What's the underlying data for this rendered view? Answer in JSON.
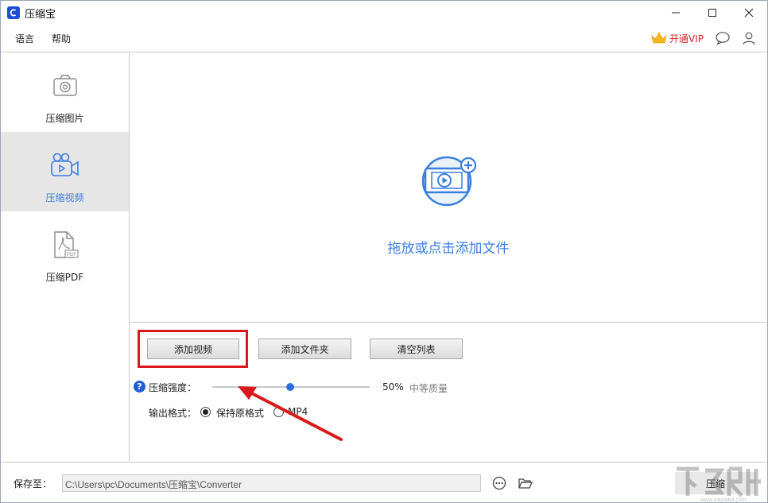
{
  "window": {
    "title": "压缩宝",
    "minimize_icon": "minimize-icon",
    "maximize_icon": "maximize-icon",
    "close_icon": "close-icon"
  },
  "menu": {
    "items": [
      "语言",
      "帮助"
    ],
    "vip_label": "开通VIP",
    "icons": [
      "crown-icon",
      "chat-bubble-icon",
      "user-icon"
    ]
  },
  "sidebar": {
    "items": [
      {
        "label": "压缩图片",
        "icon": "camera-icon",
        "active": false
      },
      {
        "label": "压缩视频",
        "icon": "video-camera-icon",
        "active": true
      },
      {
        "label": "压缩PDF",
        "icon": "pdf-file-icon",
        "active": false
      }
    ]
  },
  "dropzone": {
    "icon": "add-video-icon",
    "text": "拖放或点击添加文件"
  },
  "actions": {
    "add_video": "添加视频",
    "add_folder": "添加文件夹",
    "clear_list": "清空列表"
  },
  "compression": {
    "help": "?",
    "label": "压缩强度：",
    "value_percent": 50,
    "value_text": "50%",
    "quality_text": "中等质量"
  },
  "output_format": {
    "label": "输出格式：",
    "options": [
      "保持原格式",
      "MP4"
    ],
    "selected": "保持原格式"
  },
  "footer": {
    "save_label": "保存至：",
    "path": "C:\\Users\\pc\\Documents\\压缩宝\\Converter",
    "compress_button": "压缩",
    "watermark": "www.xiazaiba.com"
  },
  "colors": {
    "accent_blue": "#3a7ee0",
    "vip_red": "#e0232b",
    "annotation_red": "#d9191c",
    "active_sidebar_bg": "#e6e6e6"
  }
}
